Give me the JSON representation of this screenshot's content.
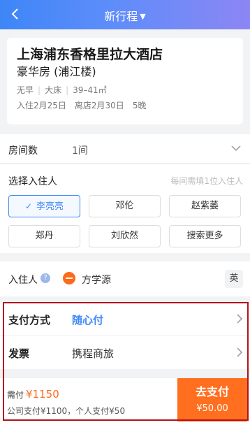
{
  "header": {
    "title": "新行程"
  },
  "hotel": {
    "name": "上海浦东香格里拉大酒店",
    "room_type": "豪华房 (浦江楼)",
    "attrs": [
      "无早",
      "大床",
      "39–41㎡"
    ],
    "checkin": "入住2月25日",
    "checkout": "离店2月30日",
    "nights": "5晚"
  },
  "rooms": {
    "label": "房间数",
    "value": "1间"
  },
  "guests": {
    "title": "选择入住人",
    "hint": "每间需填1位入住人",
    "chips": [
      "李亮亮",
      "邓伦",
      "赵紫萎",
      "郑丹",
      "刘欣然",
      "搜索更多"
    ]
  },
  "checkin_person": {
    "label": "入住人",
    "name": "方学源",
    "lang": "英"
  },
  "payment": {
    "method_label": "支付方式",
    "method_value": "随心付",
    "invoice_label": "发票",
    "invoice_value": "携程商旅"
  },
  "footer": {
    "need_label": "需付",
    "need_amount": "¥1150",
    "breakdown": "公司支付¥1100，个人支付¥50",
    "pay_title": "去支付",
    "pay_amount": "¥50.00"
  },
  "colors": {
    "accent": "#3e86f7",
    "orange": "#ff6f1f",
    "highlight": "#b0121b"
  }
}
